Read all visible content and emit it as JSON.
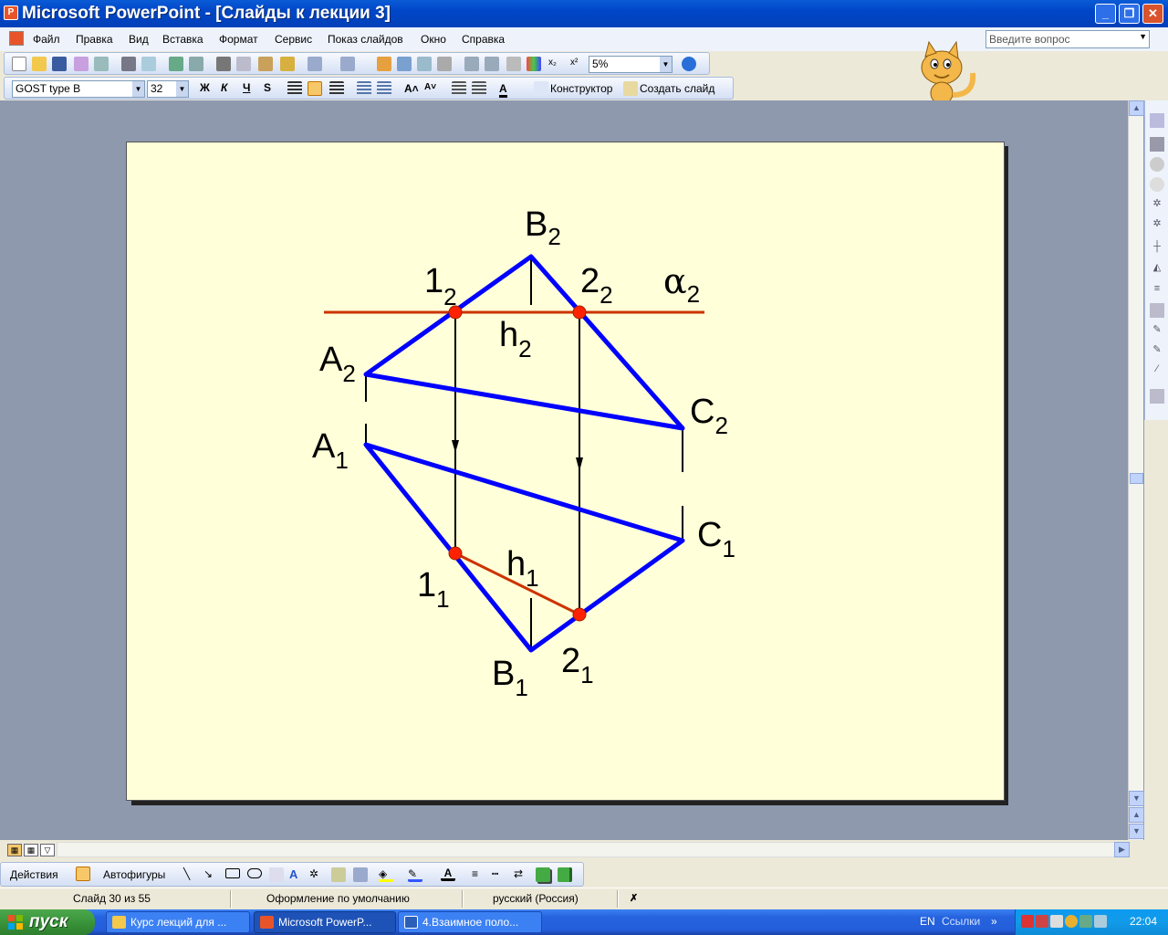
{
  "window": {
    "title": "Microsoft PowerPoint - [Слайды к лекции 3]",
    "min": "_",
    "max": "❐",
    "close": "✕"
  },
  "menu": {
    "items": [
      "Файл",
      "Правка",
      "Вид",
      "Вставка",
      "Формат",
      "Сервис",
      "Показ слайдов",
      "Окно",
      "Справка"
    ]
  },
  "ask_box": {
    "placeholder": "Введите вопрос"
  },
  "standard_toolbar": {
    "zoom": "5%"
  },
  "formatting_toolbar": {
    "font": "GOST type B",
    "size": "32",
    "bold": "Ж",
    "italic": "К",
    "underline": "Ч",
    "shadow": "S",
    "designer": "Конструктор",
    "new_slide": "Создать слайд"
  },
  "slide": {
    "labels": {
      "B2": "B",
      "B2_sub": "2",
      "n12": "1",
      "n12_sub": "2",
      "n22": "2",
      "n22_sub": "2",
      "alpha2": "α",
      "alpha2_sub": "2",
      "h2": "h",
      "h2_sub": "2",
      "A2": "A",
      "A2_sub": "2",
      "C2": "C",
      "C2_sub": "2",
      "A1": "A",
      "A1_sub": "1",
      "C1": "C",
      "C1_sub": "1",
      "h1": "h",
      "h1_sub": "1",
      "n11": "1",
      "n11_sub": "1",
      "B1": "B",
      "B1_sub": "1",
      "n21": "2",
      "n21_sub": "1"
    },
    "colors": {
      "triangle": "#0000FF",
      "plane": "#CC3300",
      "point": "#FF2200",
      "background": "#FFFFD9"
    }
  },
  "drawing_toolbar": {
    "actions": "Действия",
    "autoshapes": "Автофигуры"
  },
  "status": {
    "slide": "Слайд 30 из 55",
    "design": "Оформление по умолчанию",
    "language": "русский (Россия)"
  },
  "taskbar": {
    "start": "пуск",
    "tasks": [
      "Курс лекций для ...",
      "Microsoft PowerP...",
      "4.Взаимное поло..."
    ],
    "lang": "EN",
    "links": "Ссылки",
    "clock": "22:04"
  }
}
